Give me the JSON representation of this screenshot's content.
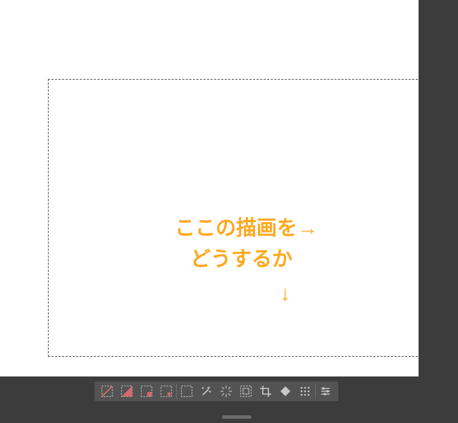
{
  "annotations": {
    "line1": "ここの描画を→",
    "line2": "どうするか",
    "arrow_down": "↓"
  },
  "colors": {
    "annotation": "#ffa81f",
    "panel": "#3c3c3c",
    "toolbar": "#535353"
  },
  "toolbar": {
    "tools": [
      "select-none",
      "select-gradient",
      "select-dotted",
      "select-add",
      "select-box",
      "magic-sparkle",
      "radial-burst",
      "border-variant",
      "crop",
      "diamond",
      "pattern-dots",
      "controls"
    ]
  }
}
